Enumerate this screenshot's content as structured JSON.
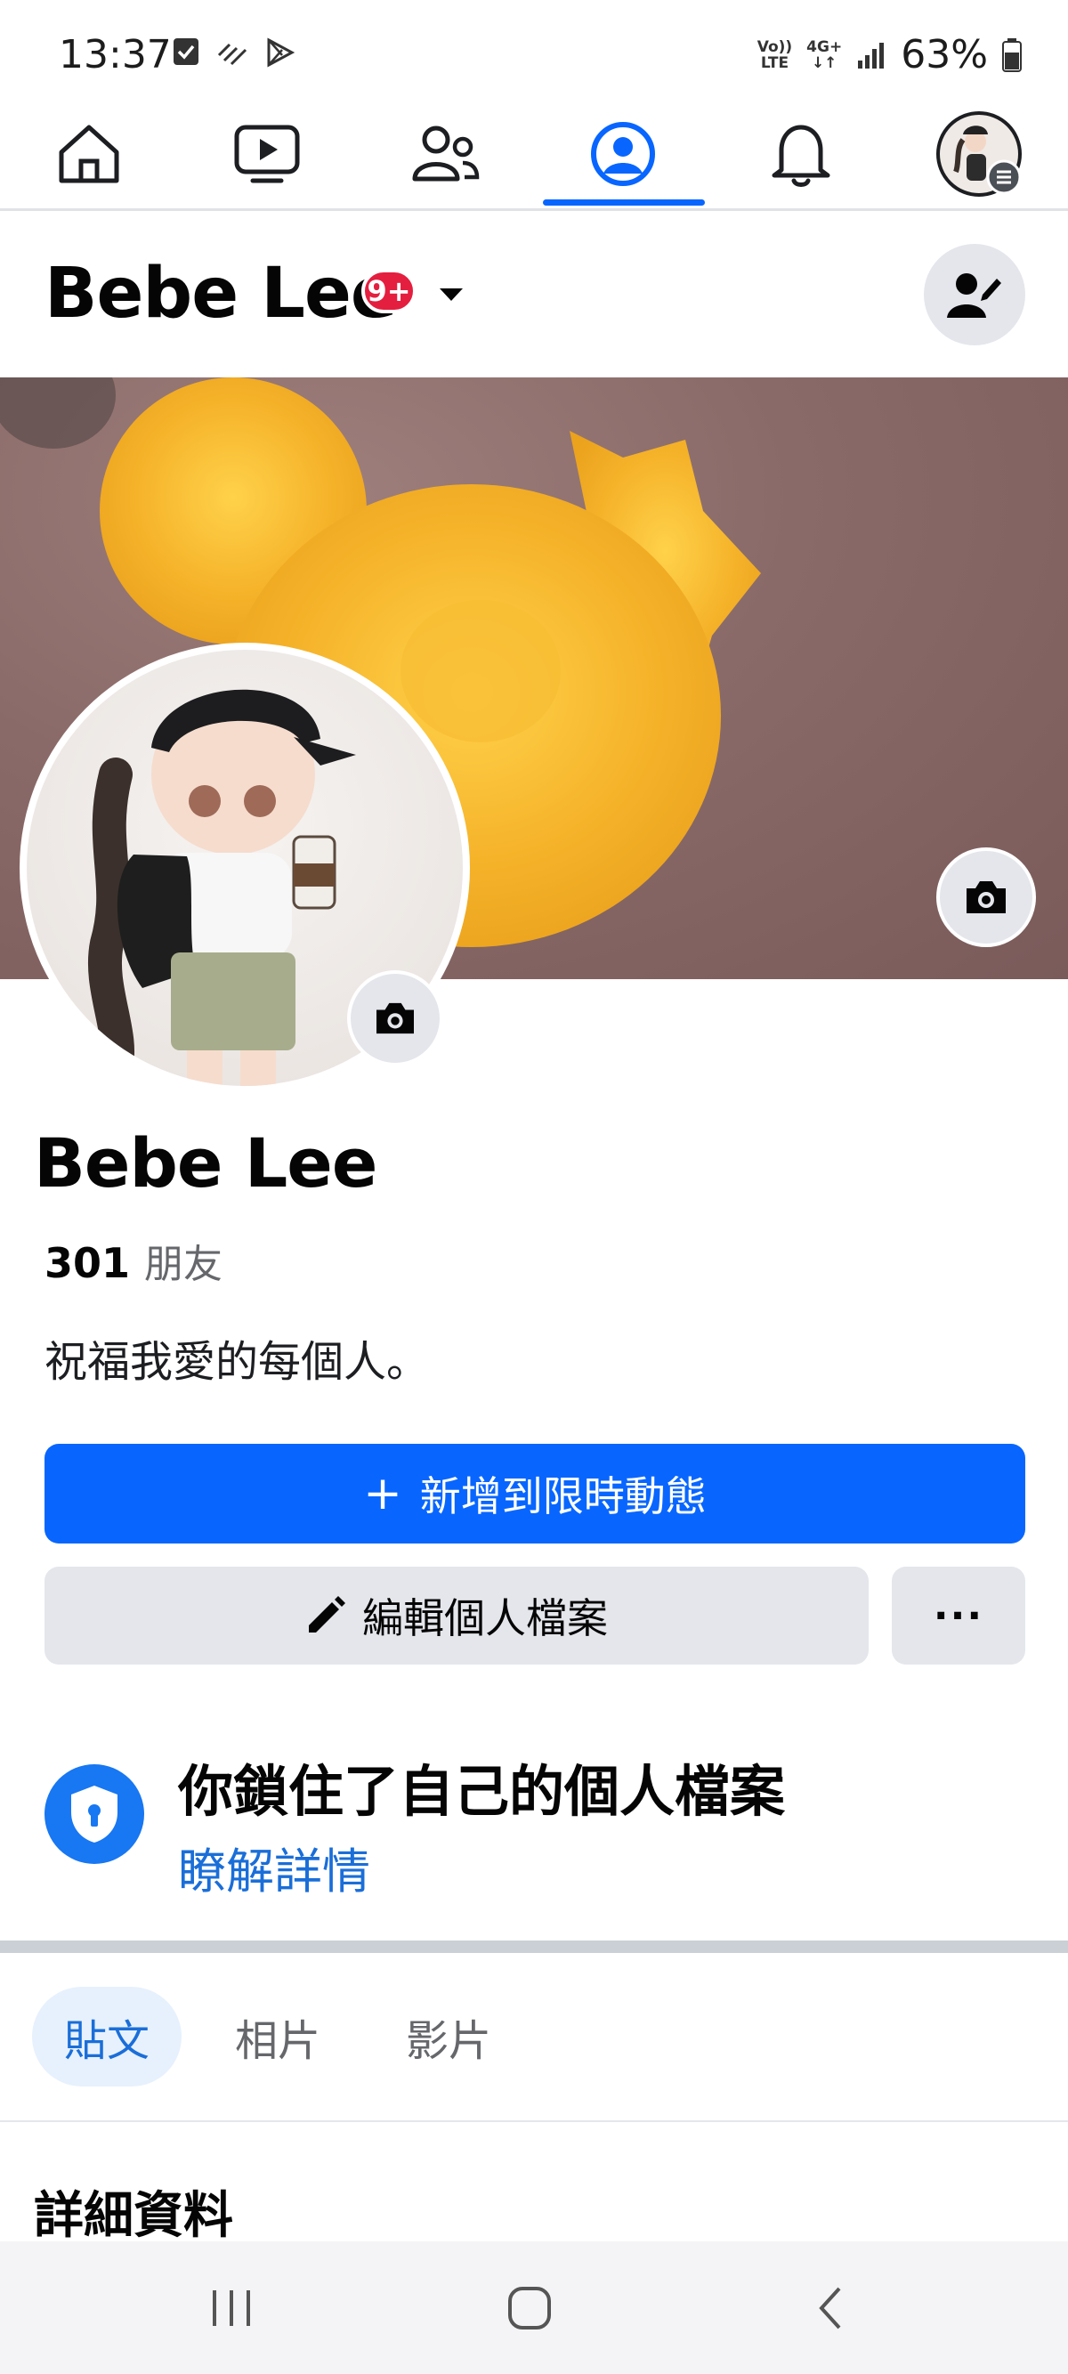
{
  "status_bar": {
    "time": "13:37",
    "network_top": "Vo))",
    "network_bottom": "LTE",
    "net_type": "4G+",
    "battery": "63%",
    "icons": [
      "checkbox-icon",
      "signal-icon",
      "play-store-icon",
      "signal-bars-icon",
      "battery-icon"
    ]
  },
  "nav": {
    "items": [
      {
        "icon": "home-icon"
      },
      {
        "icon": "video-icon"
      },
      {
        "icon": "friends-icon"
      },
      {
        "icon": "profile-icon",
        "active": true
      },
      {
        "icon": "bell-icon"
      },
      {
        "icon": "menu-avatar-icon"
      }
    ]
  },
  "header": {
    "name": "Bebe Lee",
    "badge": "9+"
  },
  "profile": {
    "name": "Bebe Lee",
    "friend_count": "301",
    "friend_label": "朋友",
    "bio": "祝福我愛的每個人。"
  },
  "actions": {
    "story_plus": "+",
    "story_label": "新增到限時動態",
    "edit_label": "編輯個人檔案",
    "more_label": "···"
  },
  "lock": {
    "title": "你鎖住了自己的個人檔案",
    "link": "瞭解詳情"
  },
  "tabs": [
    {
      "label": "貼文",
      "active": true
    },
    {
      "label": "相片",
      "active": false
    },
    {
      "label": "影片",
      "active": false
    }
  ],
  "details": {
    "title": "詳細資料"
  },
  "colors": {
    "accent": "#0866ff",
    "link": "#1a6ed8",
    "badge": "#e41e3f",
    "button_gray": "#e4e6eb"
  }
}
